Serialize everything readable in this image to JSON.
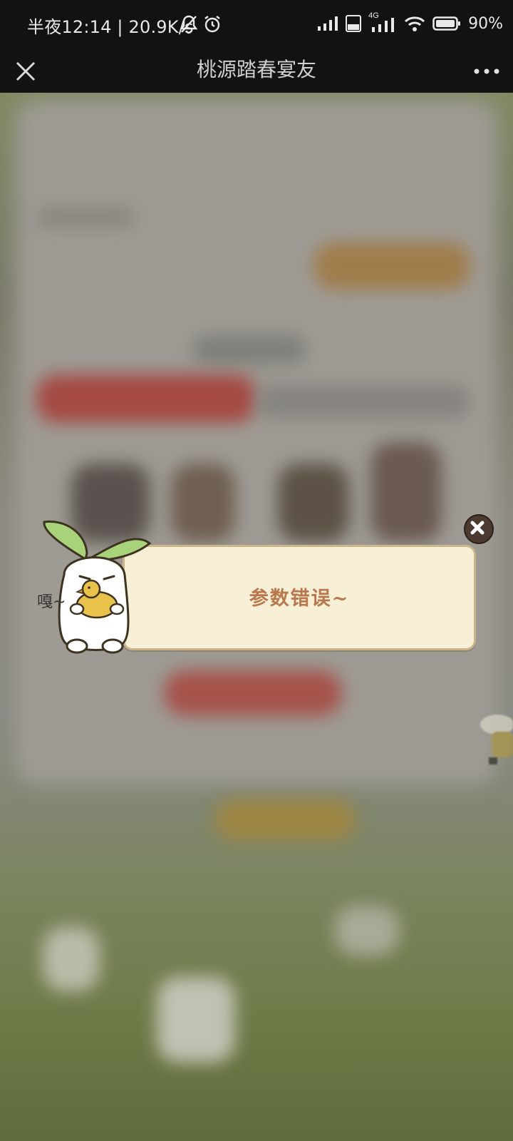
{
  "status_bar": {
    "time": "半夜12:14 | 20.9K/s",
    "network": "4G",
    "battery": "90%"
  },
  "nav": {
    "title": "桃源踏春宴友"
  },
  "dialog": {
    "message": "参数错误~",
    "mascot_sound": "嘎~"
  },
  "colors": {
    "dialog_bg": "#f7efd6",
    "dialog_border": "#cdb58b",
    "dialog_text": "#b8774d"
  }
}
